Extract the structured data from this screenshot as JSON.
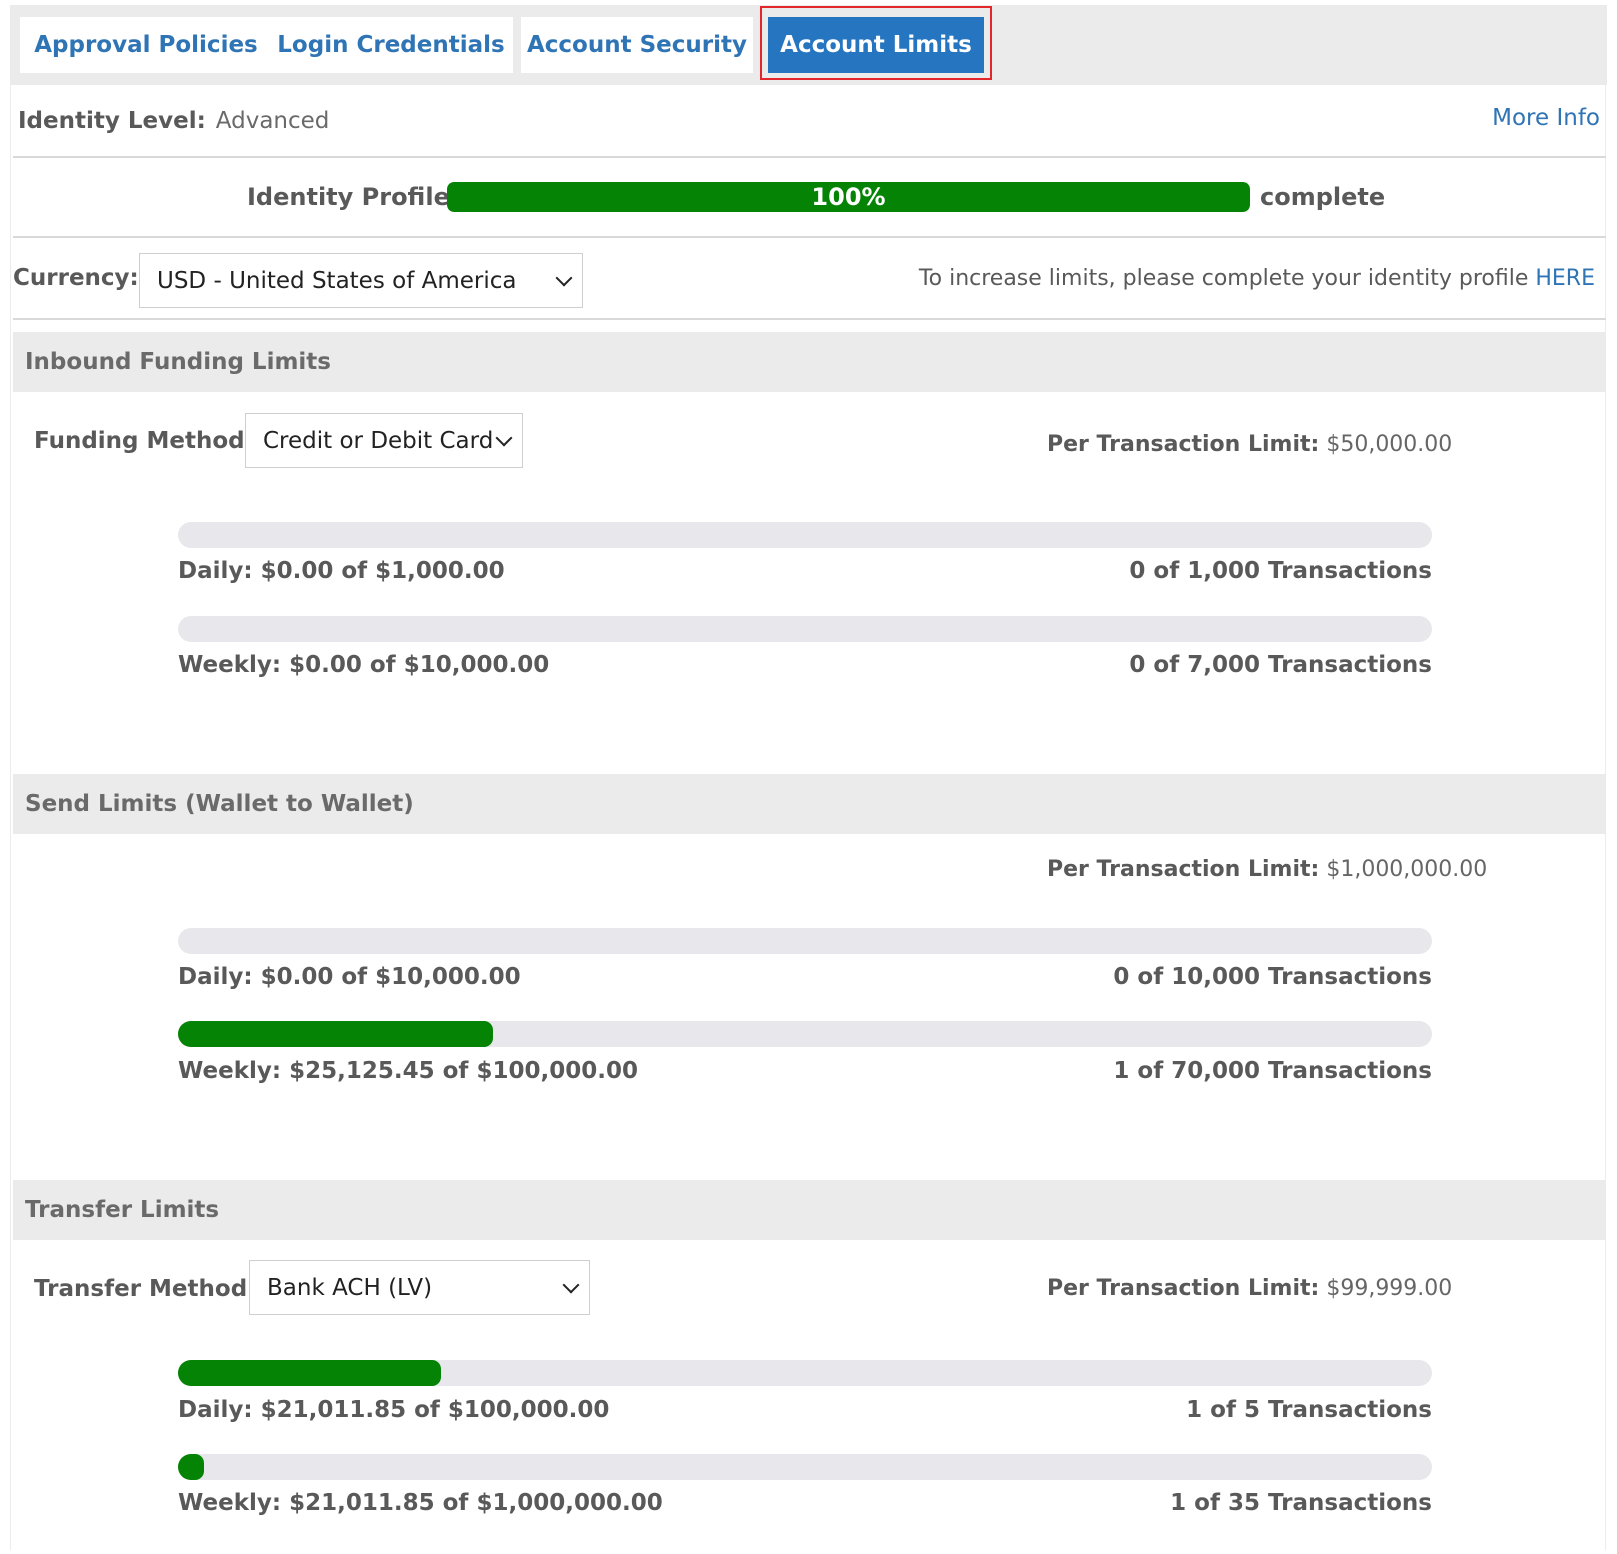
{
  "tabs": [
    {
      "label": "Approval Policies"
    },
    {
      "label": "Login Credentials"
    },
    {
      "label": "Account Security"
    },
    {
      "label": "Account Limits",
      "active": true
    }
  ],
  "identity": {
    "level_label": "Identity Level:",
    "level_value": "Advanced",
    "more_info": "More Info",
    "profile_label": "Identity Profile",
    "profile_percent": "100%",
    "profile_progress": 1.0,
    "profile_suffix": "complete"
  },
  "currency": {
    "label": "Currency:",
    "selected": "USD - United States of America",
    "increase_text": "To increase limits, please complete your identity profile ",
    "increase_link": "HERE"
  },
  "sections": {
    "inbound": {
      "title": "Inbound Funding Limits",
      "method_label": "Funding Method:",
      "method_value": "Credit or Debit Card",
      "ptl_label": "Per Transaction Limit:",
      "ptl_value": "$50,000.00",
      "daily": {
        "label": "Daily: $0.00 of $1,000.00",
        "transactions": "0 of 1,000 Transactions",
        "progress": 0
      },
      "weekly": {
        "label": "Weekly: $0.00 of $10,000.00",
        "transactions": "0 of 7,000 Transactions",
        "progress": 0
      }
    },
    "send": {
      "title": "Send Limits (Wallet to Wallet)",
      "ptl_label": "Per Transaction Limit:",
      "ptl_value": "$1,000,000.00",
      "daily": {
        "label": "Daily: $0.00 of $10,000.00",
        "transactions": "0 of 10,000 Transactions",
        "progress": 0
      },
      "weekly": {
        "label": "Weekly: $25,125.45 of $100,000.00",
        "transactions": "1 of 70,000 Transactions",
        "progress": 0.2513
      }
    },
    "transfer": {
      "title": "Transfer Limits",
      "method_label": "Transfer Method:",
      "method_value": "Bank ACH (LV)",
      "ptl_label": "Per Transaction Limit:",
      "ptl_value": "$99,999.00",
      "daily": {
        "label": "Daily: $21,011.85 of $100,000.00",
        "transactions": "1 of 5 Transactions",
        "progress": 0.2101
      },
      "weekly": {
        "label": "Weekly: $21,011.85 of $1,000,000.00",
        "transactions": "1 of 35 Transactions",
        "progress": 0.021
      }
    }
  },
  "colors": {
    "accent": "#2675c0",
    "link": "#2f74b5",
    "progress_fill": "#048304",
    "progress_track": "#e8e8ec",
    "highlight_box": "#e3262b"
  }
}
